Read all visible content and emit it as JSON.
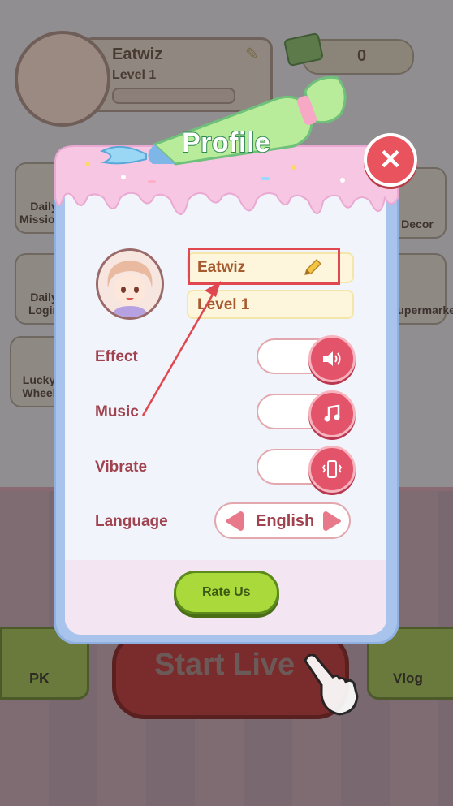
{
  "hud": {
    "player_name": "Eatwiz",
    "player_level": "Level 1",
    "money": "0",
    "side_left": [
      "Daily Missions",
      "Daily Login",
      "Lucky Wheel"
    ],
    "side_right": [
      "Decor",
      "Supermarket"
    ],
    "pk_label": "PK",
    "vlog_label": "Vlog",
    "start_label": "Start Live"
  },
  "profile": {
    "title": "Profile",
    "name": "Eatwiz",
    "level": "Level 1",
    "rows": {
      "effect_label": "Effect",
      "music_label": "Music",
      "vibrate_label": "Vibrate",
      "language_label": "Language"
    },
    "language_value": "English",
    "rate_label": "Rate Us"
  },
  "colors": {
    "accent_pink": "#e3546a",
    "label_red": "#a0434f",
    "rate_green": "#a9d93a",
    "close_red": "#e8535d",
    "highlight_red": "#e0474e"
  },
  "icons": [
    "speaker-icon",
    "music-note-icon",
    "vibrate-phone-icon",
    "pencil-icon",
    "close-icon",
    "arrow-left-icon",
    "arrow-right-icon"
  ]
}
